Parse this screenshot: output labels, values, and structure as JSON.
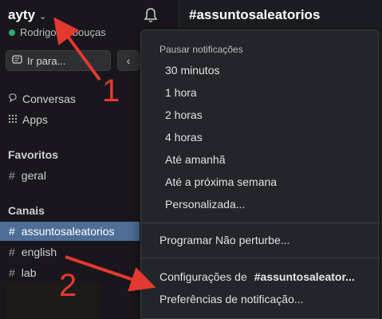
{
  "workspace": {
    "name": "ayty",
    "user": "Rodrigo Rebouças"
  },
  "search": {
    "label": "Ir para..."
  },
  "nav": {
    "conversations": "Conversas",
    "apps": "Apps"
  },
  "sections": {
    "favorites": "Favoritos",
    "channels": "Canais"
  },
  "favorites": [
    {
      "label": "geral"
    }
  ],
  "channels": [
    {
      "label": "assuntosaleatorios",
      "active": true
    },
    {
      "label": "english"
    },
    {
      "label": "lab"
    }
  ],
  "main": {
    "title": "#assuntosaleatorios"
  },
  "menu": {
    "header": "Pausar notificações",
    "pause_options": [
      "30 minutos",
      "1 hora",
      "2 horas",
      "4 horas",
      "Até amanhã",
      "Até a próxima semana",
      "Personalizada..."
    ],
    "schedule": "Programar Não perturbe...",
    "settings_prefix": "Configurações de",
    "settings_channel": "#assuntosaleator...",
    "preferences": "Preferências de notificação..."
  },
  "annotations": {
    "arrow1_number": "1",
    "arrow2_number": "2"
  },
  "colors": {
    "active_channel": "#4e6e97",
    "presence": "#2bac76",
    "annotation": "#e4392f"
  }
}
